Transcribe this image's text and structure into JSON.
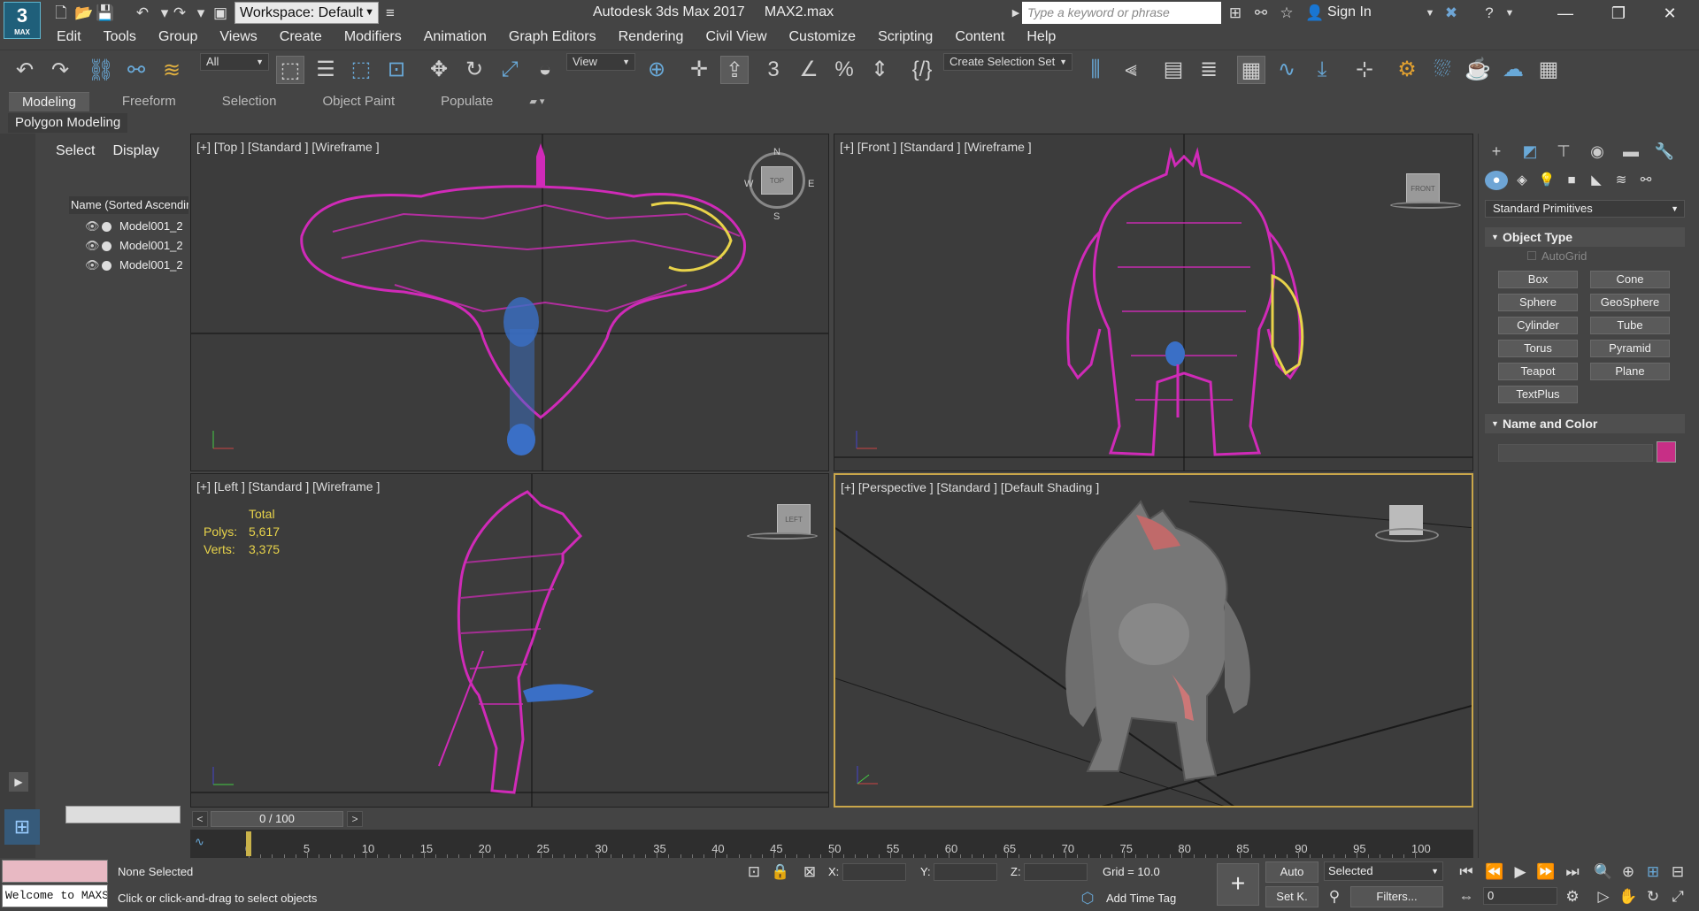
{
  "app": {
    "logo_main": "3",
    "logo_sub": "MAX",
    "title": "Autodesk 3ds Max 2017     MAX2.max",
    "workspace_label": "Workspace: Default",
    "search_placeholder": "Type a keyword or phrase",
    "signin": "Sign In"
  },
  "menu": [
    "Edit",
    "Tools",
    "Group",
    "Views",
    "Create",
    "Modifiers",
    "Animation",
    "Graph Editors",
    "Rendering",
    "Civil View",
    "Customize",
    "Scripting",
    "Content",
    "Help"
  ],
  "toolbar": {
    "filter": "All",
    "ref_coord": "View",
    "selection_set": "Create Selection Set"
  },
  "ribbon": {
    "tabs": [
      "Modeling",
      "Freeform",
      "Selection",
      "Object Paint",
      "Populate"
    ],
    "subtitle": "Polygon Modeling"
  },
  "scene_explorer": {
    "tabs": [
      "Select",
      "Display"
    ],
    "column_header": "Name (Sorted Ascending)",
    "items": [
      "Model001_2",
      "Model001_2",
      "Model001_2"
    ]
  },
  "viewports": {
    "top": "[+] [Top ] [Standard ] [Wireframe ]",
    "front": "[+] [Front ] [Standard ] [Wireframe ]",
    "left": "[+] [Left ] [Standard ] [Wireframe ]",
    "perspective": "[+] [Perspective ] [Standard ] [Default Shading ]",
    "compass": {
      "n": "N",
      "s": "S",
      "e": "E",
      "w": "W",
      "cube": "TOP"
    },
    "front_cube": "FRONT",
    "left_cube": "LEFT",
    "stats": {
      "title": "Total",
      "polys_label": "Polys:",
      "polys": "5,617",
      "verts_label": "Verts:",
      "verts": "3,375"
    }
  },
  "command_panel": {
    "category": "Standard Primitives",
    "object_type_title": "Object Type",
    "autogrid": "AutoGrid",
    "buttons": [
      "Box",
      "Cone",
      "Sphere",
      "GeoSphere",
      "Cylinder",
      "Tube",
      "Torus",
      "Pyramid",
      "Teapot",
      "Plane",
      "TextPlus"
    ],
    "name_color_title": "Name and Color",
    "color": "#c72f86"
  },
  "timeline": {
    "frame_display": "0 / 100",
    "ticks": [
      "0",
      "5",
      "10",
      "15",
      "20",
      "25",
      "30",
      "35",
      "40",
      "45",
      "50",
      "55",
      "60",
      "65",
      "70",
      "75",
      "80",
      "85",
      "90",
      "95",
      "100"
    ]
  },
  "status": {
    "selection": "None Selected",
    "prompt": "Click or click-and-drag to select objects",
    "x_label": "X:",
    "y_label": "Y:",
    "z_label": "Z:",
    "grid": "Grid = 10.0",
    "add_time_tag": "Add Time Tag",
    "auto": "Auto",
    "set_key": "Set K.",
    "key_mode": "Selected",
    "filters": "Filters...",
    "frame": "0",
    "maxscript": "Welcome to MAXScript."
  },
  "colors": {
    "wireframe": "#d02ab8",
    "wire_selected": "#e8d34a",
    "wire_blue": "#3a6fc6",
    "viewport_bg": "#3c3c3c",
    "active_border": "#c9a64a"
  }
}
